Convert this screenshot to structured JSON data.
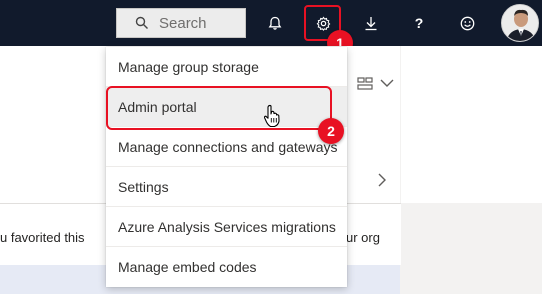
{
  "topbar": {
    "search_placeholder": "Search",
    "icons": [
      "search-icon",
      "bell-icon",
      "gear-icon",
      "download-icon",
      "help-icon",
      "smiley-icon",
      "avatar"
    ]
  },
  "annotations": {
    "step1": "1",
    "step2": "2",
    "highlight_color": "#e81123"
  },
  "menu": {
    "items": [
      {
        "label": "Manage group storage"
      },
      {
        "label": "Admin portal"
      },
      {
        "label": "Manage connections and gateways"
      },
      {
        "label": "Settings"
      },
      {
        "label": "Azure Analysis Services migrations"
      },
      {
        "label": "Manage embed codes"
      }
    ]
  },
  "background": {
    "favorited_text": "u favorited this",
    "org_text": "ur org"
  }
}
